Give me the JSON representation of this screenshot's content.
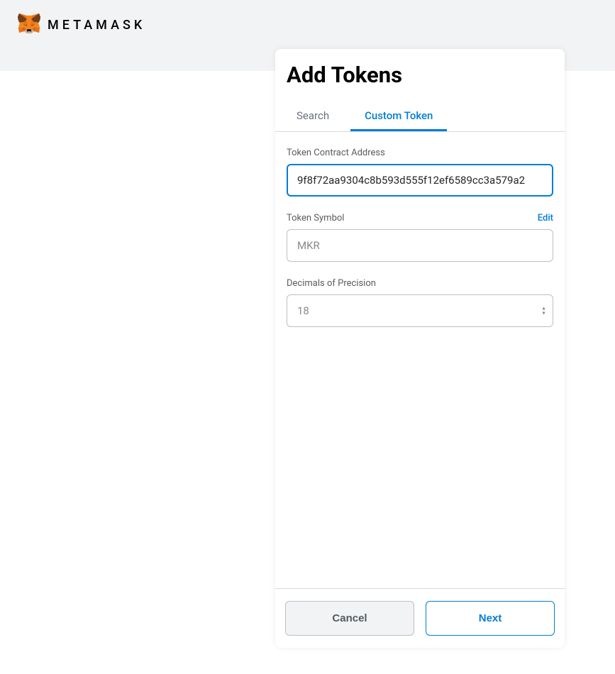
{
  "header": {
    "brand": "METAMASK"
  },
  "modal": {
    "title": "Add Tokens",
    "tabs": {
      "search": "Search",
      "custom": "Custom Token"
    },
    "fields": {
      "contract_label": "Token Contract Address",
      "contract_value": "9f8f72aa9304c8b593d555f12ef6589cc3a579a2",
      "symbol_label": "Token Symbol",
      "symbol_edit": "Edit",
      "symbol_value": "MKR",
      "decimals_label": "Decimals of Precision",
      "decimals_value": "18"
    },
    "footer": {
      "cancel": "Cancel",
      "next": "Next"
    }
  }
}
